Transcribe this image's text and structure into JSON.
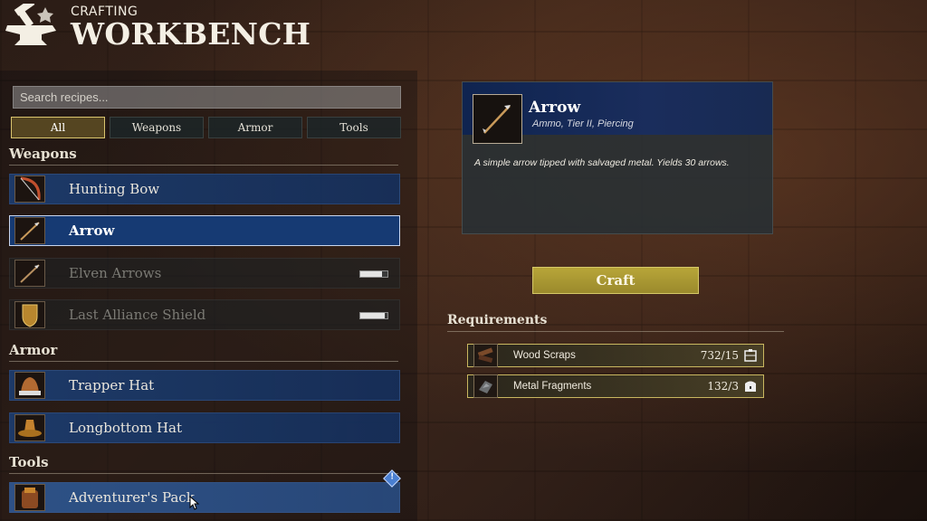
{
  "header": {
    "subtitle": "CRAFTING",
    "title": "WORKBENCH"
  },
  "search": {
    "placeholder": "Search recipes..."
  },
  "tabs": [
    {
      "label": "All",
      "active": true
    },
    {
      "label": "Weapons",
      "active": false
    },
    {
      "label": "Armor",
      "active": false
    },
    {
      "label": "Tools",
      "active": false
    }
  ],
  "sections": {
    "weapons": {
      "header": "Weapons",
      "items": [
        {
          "label": "Hunting Bow",
          "icon": "bow-icon"
        },
        {
          "label": "Arrow",
          "icon": "arrow-icon",
          "selected": true
        },
        {
          "label": "Elven Arrows",
          "icon": "arrow-icon",
          "locked": true,
          "progress": 0.8
        },
        {
          "label": "Last Alliance Shield",
          "icon": "shield-icon",
          "locked": true,
          "progress": 0.9
        }
      ]
    },
    "armor": {
      "header": "Armor",
      "items": [
        {
          "label": "Trapper Hat",
          "icon": "hat-icon"
        },
        {
          "label": "Longbottom Hat",
          "icon": "hat-icon"
        }
      ]
    },
    "tools": {
      "header": "Tools",
      "items": [
        {
          "label": "Adventurer's Pack",
          "icon": "pack-icon",
          "has_notice": true
        }
      ]
    }
  },
  "notice_mark": "!",
  "detail": {
    "name": "Arrow",
    "subtitle": "Ammo, Tier II, Piercing",
    "description": "A simple arrow tipped with salvaged metal. Yields 30 arrows."
  },
  "craft_button": {
    "label": "Craft"
  },
  "requirements": {
    "header": "Requirements",
    "items": [
      {
        "label": "Wood Scraps",
        "count": "732/15",
        "icon": "wood-icon",
        "badge": "storage-icon"
      },
      {
        "label": "Metal Fragments",
        "count": "132/3",
        "icon": "metal-icon",
        "badge": "chest-icon"
      }
    ]
  },
  "colors": {
    "accent_gold": "#b8a539",
    "selected_blue": "#163a73",
    "item_blue": "#1c3c6e"
  }
}
